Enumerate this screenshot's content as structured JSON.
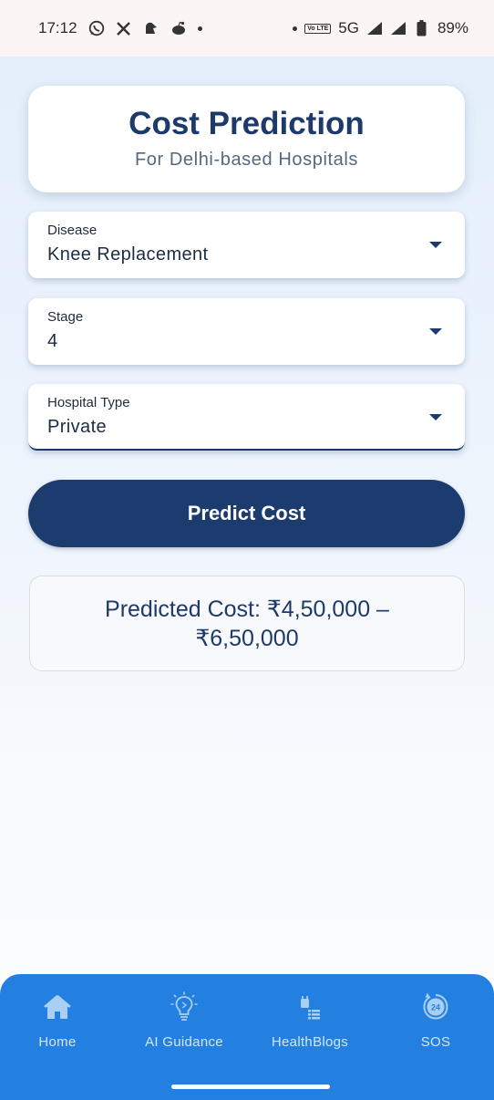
{
  "status_bar": {
    "time": "17:12",
    "volte_label": "Vo LTE",
    "network": "5G",
    "battery": "89%",
    "left_icons": [
      "whatsapp-icon",
      "x-icon",
      "notification-app-icon",
      "reddit-icon"
    ]
  },
  "header": {
    "title": "Cost Prediction",
    "subtitle": "For Delhi-based Hospitals"
  },
  "form": {
    "disease": {
      "label": "Disease",
      "value": "Knee Replacement"
    },
    "stage": {
      "label": "Stage",
      "value": "4"
    },
    "hospital_type": {
      "label": "Hospital Type",
      "value": "Private"
    }
  },
  "predict_button": {
    "label": "Predict Cost"
  },
  "result": {
    "text": "Predicted Cost: ₹4,50,000 – ₹6,50,000"
  },
  "bottom_nav": {
    "items": [
      {
        "label": "Home",
        "icon": "home-icon"
      },
      {
        "label": "AI Guidance",
        "icon": "lightbulb-icon"
      },
      {
        "label": "HealthBlogs",
        "icon": "blog-icon"
      },
      {
        "label": "SOS",
        "icon": "sos-24-icon"
      }
    ]
  },
  "colors": {
    "primary": "#1c3b6e",
    "nav_background": "#2480e0",
    "nav_label": "#d4e6fb"
  }
}
